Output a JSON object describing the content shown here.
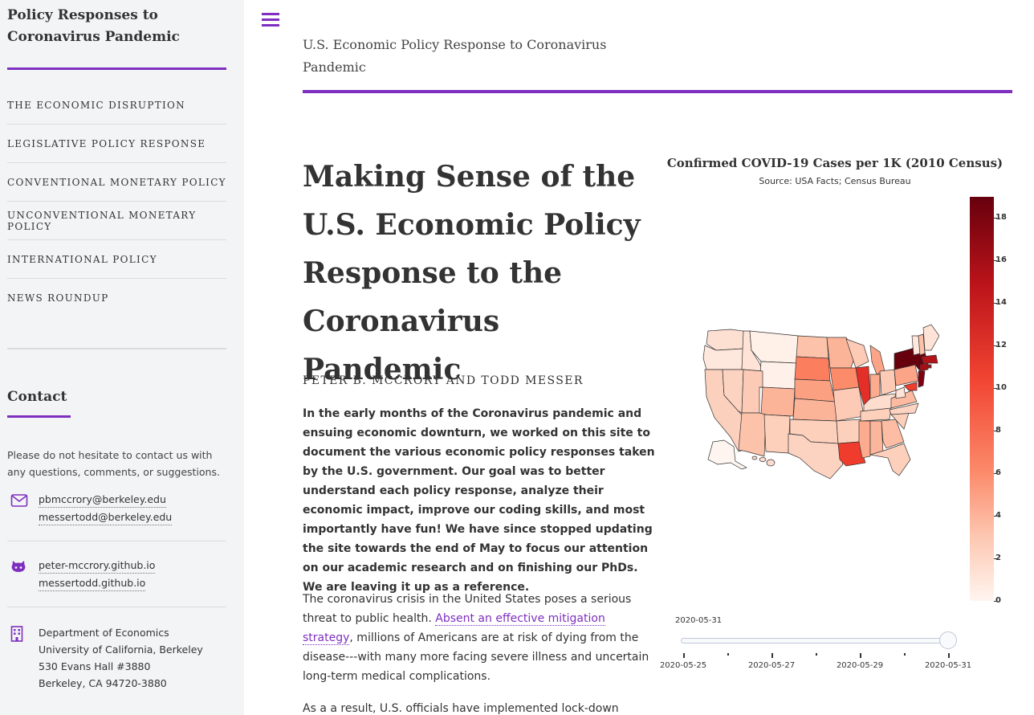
{
  "sidebar": {
    "site_title": "Policy Responses to Coronavirus Pandemic",
    "nav": [
      "THE ECONOMIC DISRUPTION",
      "LEGISLATIVE POLICY RESPONSE",
      "CONVENTIONAL MONETARY POLICY",
      "UNCONVENTIONAL MONETARY POLICY",
      "INTERNATIONAL POLICY",
      "NEWS ROUNDUP"
    ],
    "contact_heading": "Contact",
    "contact_intro": "Please do not hesitate to contact us with any questions, comments, or suggestions.",
    "emails": [
      "pbmccrory@berkeley.edu",
      "messertodd@berkeley.edu"
    ],
    "sites": [
      "peter-mccrory.github.io",
      "messertodd.github.io"
    ],
    "address": [
      "Department of Economics",
      "University of California, Berkeley",
      "530 Evans Hall #3880",
      "Berkeley, CA 94720-3880"
    ],
    "icons": {
      "email": "envelope-icon",
      "github": "github-icon",
      "address": "building-icon"
    }
  },
  "header": {
    "menu_icon": "hamburger-icon",
    "page_header": "U.S. Economic Policy Response to Coronavirus Pandemic"
  },
  "article": {
    "title": "Making Sense of the U.S. Economic Policy Response to the Coronavirus Pandemic",
    "authors": "PETER B. MCCRORY AND TODD MESSER",
    "lead": "In the early months of the Coronavirus pandemic and ensuing economic downturn, we worked on this site to document the various economic policy responses taken by the U.S. government. Our goal was to better understand each policy response, analyze their economic impact, improve our coding skills, and most importantly have fun! We have since stopped updating the site towards the end of May to focus our attention on our academic research and on finishing our PhDs. We are leaving it up as a reference.",
    "para1_before": "The coronavirus crisis in the United States poses a serious threat to public health. ",
    "para1_link": "Absent an effective mitigation strategy",
    "para1_after": ", millions of Americans are at risk of dying from the disease---with many more facing severe illness and uncertain long-term medical complications.",
    "para2": "As a a result, U.S. officials have implemented lock-down"
  },
  "chart": {
    "title": "Confirmed COVID-19 Cases per 1K (2010 Census)",
    "subtitle": "Source: USA Facts; Census Bureau",
    "colorbar_ticks": [
      "0",
      "2",
      "4",
      "6",
      "8",
      "10",
      "12",
      "14",
      "16",
      "18"
    ],
    "slider_current": "2020-05-31",
    "slider_labels": [
      "2020-05-25",
      "2020-05-27",
      "2020-05-29",
      "2020-05-31"
    ],
    "accent": "#7e2fbf"
  },
  "chart_data": {
    "type": "heatmap",
    "title": "Confirmed COVID-19 Cases per 1K (2010 Census)",
    "subtitle": "Source: USA Facts; Census Bureau",
    "colorscale": "Reds",
    "zrange": [
      0,
      19
    ],
    "date": "2020-05-31",
    "date_range": [
      "2020-05-25",
      "2020-05-31"
    ]
  }
}
